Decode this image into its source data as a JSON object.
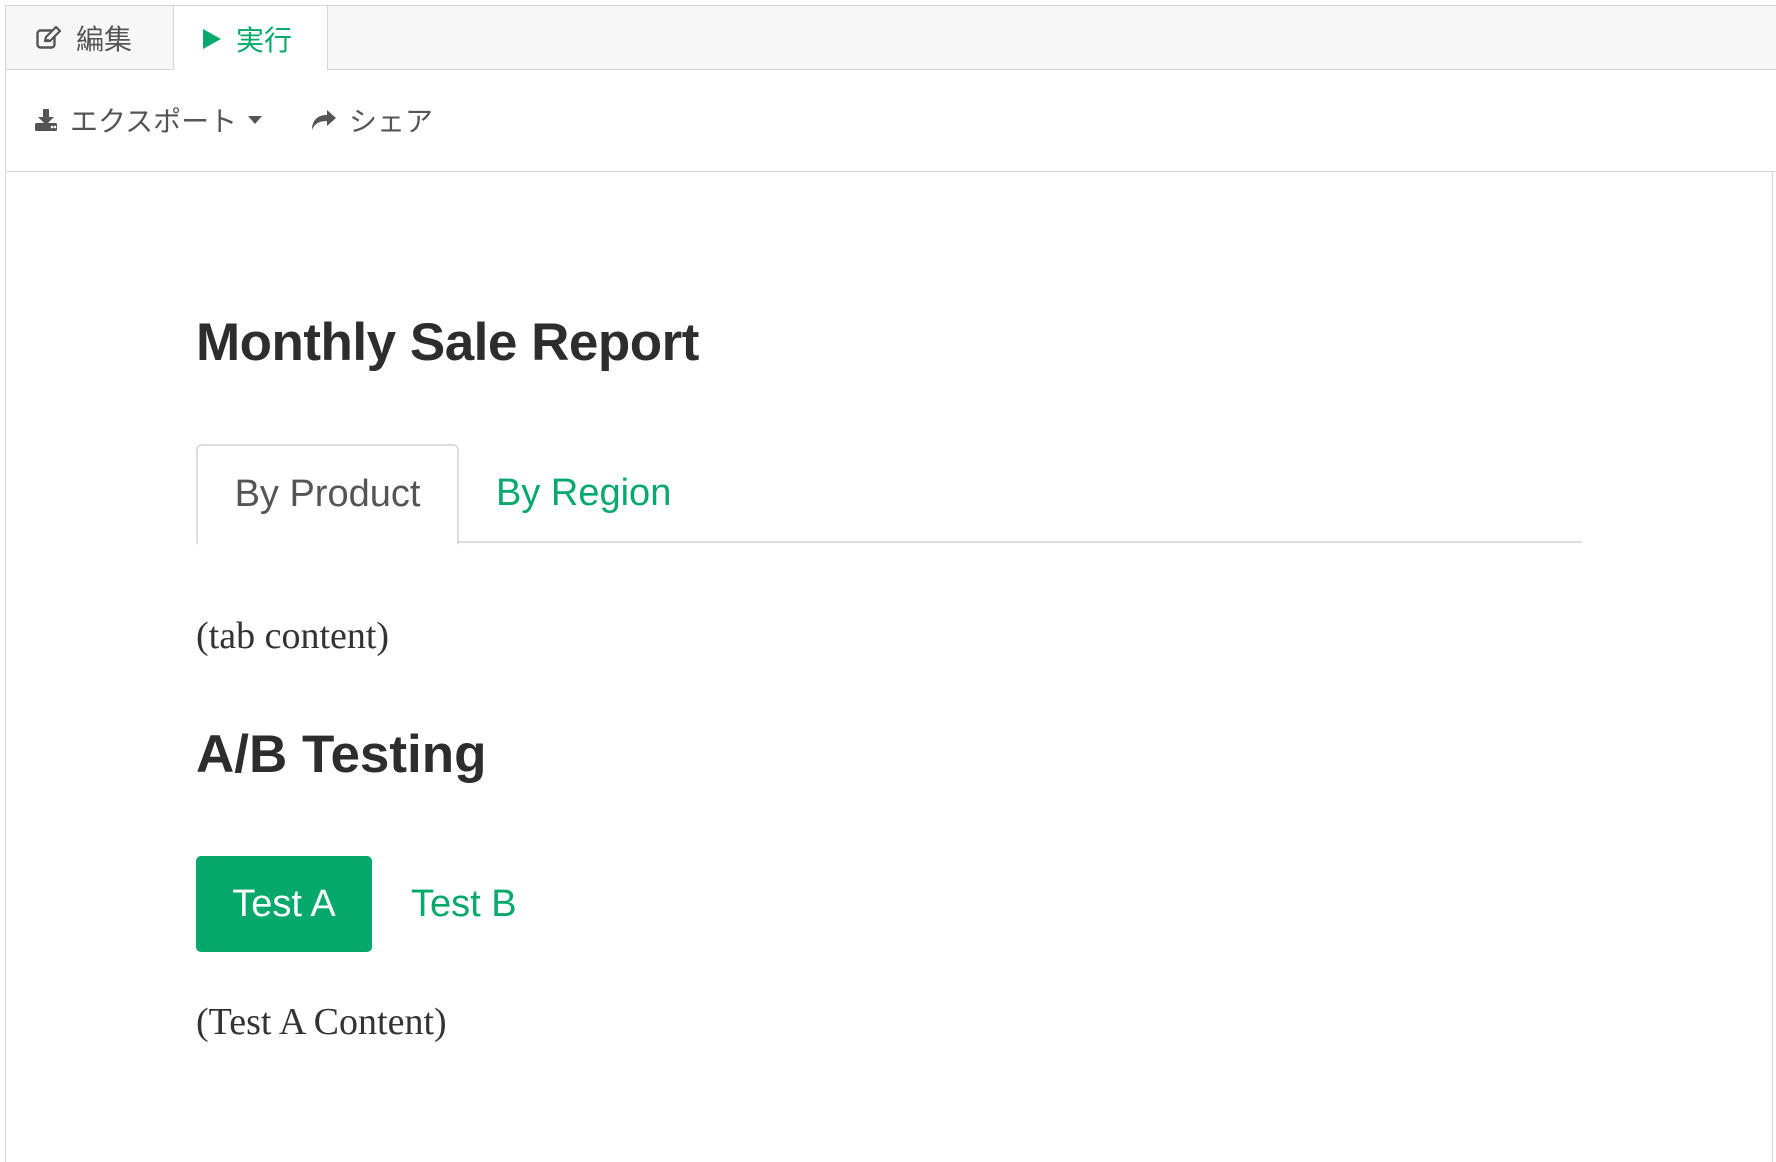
{
  "mode_tabs": {
    "edit_label": "編集",
    "run_label": "実行"
  },
  "toolbar": {
    "export_label": "エクスポート",
    "share_label": "シェア"
  },
  "report": {
    "title": "Monthly Sale Report",
    "tabs": [
      {
        "label": "By Product",
        "active": true
      },
      {
        "label": "By Region",
        "active": false
      }
    ],
    "tab_content": "(tab content)"
  },
  "ab_testing": {
    "title": "A/B Testing",
    "pills": [
      {
        "label": "Test A",
        "active": true
      },
      {
        "label": "Test B",
        "active": false
      }
    ],
    "content": "(Test A Content)"
  },
  "colors": {
    "accent": "#06a96b",
    "text": "#333333",
    "border": "#dddddd"
  },
  "icons": {
    "edit": "edit-icon",
    "run": "play-icon",
    "export": "download-icon",
    "dropdown": "caret-down-icon",
    "share": "share-icon"
  }
}
